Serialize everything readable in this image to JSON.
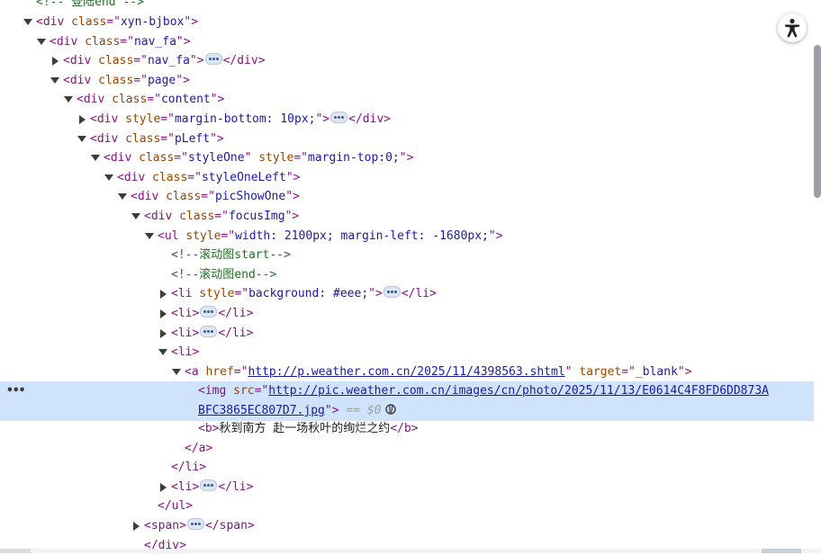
{
  "tree": [
    {
      "c": "cmt",
      "t": "<!-- 登陆end -->"
    },
    {
      "tog": "down",
      "parts": [
        [
          "tag",
          "<div "
        ],
        [
          "attr",
          "class"
        ],
        [
          "tag",
          "=\""
        ],
        [
          "aval",
          "xyn-bjbox"
        ],
        [
          "tag",
          "\">"
        ]
      ]
    },
    {
      "tog": "down",
      "parts": [
        [
          "tag",
          "<div "
        ],
        [
          "attr",
          "class"
        ],
        [
          "tag",
          "=\""
        ],
        [
          "aval",
          "nav_fa"
        ],
        [
          "tag",
          "\">"
        ]
      ]
    },
    {
      "tog": "right",
      "parts": [
        [
          "tag",
          "<div "
        ],
        [
          "attr",
          "class"
        ],
        [
          "tag",
          "=\""
        ],
        [
          "aval",
          "nav_fa"
        ],
        [
          "tag",
          "\">"
        ],
        [
          "ell",
          ""
        ],
        [
          "tag",
          "</div>"
        ]
      ]
    },
    {
      "tog": "down",
      "parts": [
        [
          "tag",
          "<div "
        ],
        [
          "attr",
          "class"
        ],
        [
          "tag",
          "=\""
        ],
        [
          "aval",
          "page"
        ],
        [
          "tag",
          "\">"
        ]
      ]
    },
    {
      "tog": "down",
      "parts": [
        [
          "tag",
          "<div "
        ],
        [
          "attr",
          "class"
        ],
        [
          "tag",
          "=\""
        ],
        [
          "aval",
          "content"
        ],
        [
          "tag",
          "\">"
        ]
      ]
    },
    {
      "tog": "right",
      "parts": [
        [
          "tag",
          "<div "
        ],
        [
          "attr",
          "style"
        ],
        [
          "tag",
          "=\""
        ],
        [
          "aval",
          "margin-bottom: 10px;"
        ],
        [
          "tag",
          "\">"
        ],
        [
          "ell",
          ""
        ],
        [
          "tag",
          "</div>"
        ]
      ]
    },
    {
      "tog": "down",
      "parts": [
        [
          "tag",
          "<div "
        ],
        [
          "attr",
          "class"
        ],
        [
          "tag",
          "=\""
        ],
        [
          "aval",
          "pLeft"
        ],
        [
          "tag",
          "\">"
        ]
      ]
    },
    {
      "tog": "down",
      "parts": [
        [
          "tag",
          "<div "
        ],
        [
          "attr",
          "class"
        ],
        [
          "tag",
          "=\""
        ],
        [
          "aval",
          "styleOne"
        ],
        [
          "tag",
          "\" "
        ],
        [
          "attr",
          "style"
        ],
        [
          "tag",
          "=\""
        ],
        [
          "aval",
          "margin-top:0;"
        ],
        [
          "tag",
          "\">"
        ]
      ]
    },
    {
      "tog": "down",
      "parts": [
        [
          "tag",
          "<div "
        ],
        [
          "attr",
          "class"
        ],
        [
          "tag",
          "=\""
        ],
        [
          "aval",
          "styleOneLeft"
        ],
        [
          "tag",
          "\">"
        ]
      ]
    },
    {
      "tog": "down",
      "parts": [
        [
          "tag",
          "<div "
        ],
        [
          "attr",
          "class"
        ],
        [
          "tag",
          "=\""
        ],
        [
          "aval",
          "picShowOne"
        ],
        [
          "tag",
          "\">"
        ]
      ]
    },
    {
      "tog": "down",
      "parts": [
        [
          "tag",
          "<div "
        ],
        [
          "attr",
          "class"
        ],
        [
          "tag",
          "=\""
        ],
        [
          "aval",
          "focusImg"
        ],
        [
          "tag",
          "\">"
        ]
      ]
    },
    {
      "tog": "down",
      "parts": [
        [
          "tag",
          "<ul "
        ],
        [
          "attr",
          "style"
        ],
        [
          "tag",
          "=\""
        ],
        [
          "aval",
          "width: 2100px; margin-left: -1680px;"
        ],
        [
          "tag",
          "\">"
        ]
      ]
    },
    {
      "parts": [
        [
          "cmt",
          "<!--滚动图start-->"
        ]
      ]
    },
    {
      "parts": [
        [
          "cmt",
          "<!--滚动图end-->"
        ]
      ]
    },
    {
      "tog": "right",
      "parts": [
        [
          "tag",
          "<li "
        ],
        [
          "attr",
          "style"
        ],
        [
          "tag",
          "=\""
        ],
        [
          "aval",
          "background: #eee;"
        ],
        [
          "tag",
          "\">"
        ],
        [
          "ell",
          ""
        ],
        [
          "tag",
          "</li>"
        ]
      ]
    },
    {
      "tog": "right",
      "parts": [
        [
          "tag",
          "<li>"
        ],
        [
          "ell",
          ""
        ],
        [
          "tag",
          "</li>"
        ]
      ]
    },
    {
      "tog": "right",
      "parts": [
        [
          "tag",
          "<li>"
        ],
        [
          "ell",
          ""
        ],
        [
          "tag",
          "</li>"
        ]
      ]
    },
    {
      "tog": "down",
      "parts": [
        [
          "tag",
          "<li>"
        ]
      ]
    },
    {
      "tog": "down",
      "parts": [
        [
          "tag",
          "<a "
        ],
        [
          "attr",
          "href"
        ],
        [
          "tag",
          "=\""
        ],
        [
          "link",
          "http://p.weather.com.cn/2025/11/4398563.shtml"
        ],
        [
          "tag",
          "\" "
        ],
        [
          "attr",
          "target"
        ],
        [
          "tag",
          "=\""
        ],
        [
          "aval",
          "_blank"
        ],
        [
          "tag",
          "\">"
        ]
      ]
    },
    {
      "hl": true,
      "dots": "•••",
      "parts": [
        [
          "tag",
          "<img "
        ],
        [
          "attr",
          "src"
        ],
        [
          "tag",
          "=\""
        ],
        [
          "link",
          "http://pic.weather.com.cn/images/cn/photo/2025/11/13/E0614C4F8FD6DD873A"
        ]
      ],
      "parts2": [
        [
          "link",
          "BFC3865EC807D7.jpg"
        ],
        [
          "tag",
          "\">"
        ],
        [
          "dim",
          " == $0"
        ],
        [
          "scope",
          ""
        ]
      ]
    },
    {
      "parts": [
        [
          "tag",
          "<b>"
        ],
        [
          "txt",
          "秋到南方 赴一场秋叶的绚烂之约"
        ],
        [
          "tag",
          "</b>"
        ]
      ]
    },
    {
      "parts": [
        [
          "tag",
          "</a>"
        ]
      ]
    },
    {
      "parts": [
        [
          "tag",
          "</li>"
        ]
      ]
    },
    {
      "tog": "right",
      "parts": [
        [
          "tag",
          "<li>"
        ],
        [
          "ell",
          ""
        ],
        [
          "tag",
          "</li>"
        ]
      ]
    },
    {
      "parts": [
        [
          "tag",
          "</ul>"
        ]
      ]
    },
    {
      "tog": "right",
      "parts": [
        [
          "tag",
          "<span>"
        ],
        [
          "ell",
          ""
        ],
        [
          "tag",
          "</span>"
        ]
      ]
    },
    {
      "parts": [
        [
          "tag",
          "</div>"
        ]
      ]
    }
  ],
  "a11y_icon": "accessibility-icon",
  "colors": {
    "tag": "#881280",
    "attr": "#994500",
    "value": "#1a1aa6",
    "comment": "#236e25",
    "selected": "#cfe3fc"
  }
}
